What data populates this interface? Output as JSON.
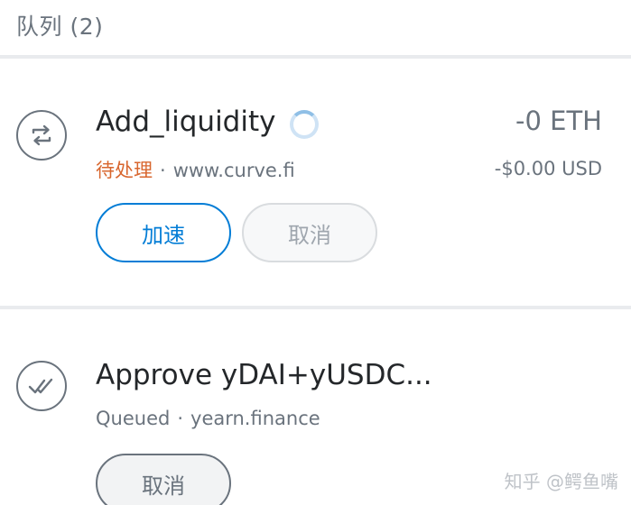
{
  "queue": {
    "title": "队列 (2)"
  },
  "transactions": [
    {
      "title": "Add_liquidity",
      "status": "待处理",
      "separator": "·",
      "origin": "www.curve.fi",
      "amount_primary": "-0 ETH",
      "amount_secondary": "-$0.00 USD",
      "speed_up_label": "加速",
      "cancel_label": "取消",
      "icon": "swap-arrows-icon",
      "status_color": "#d8662e"
    },
    {
      "title": "Approve yDAI+yUSDC...",
      "status": "Queued",
      "separator": "·",
      "origin": "yearn.finance",
      "cancel_label": "取消",
      "icon": "double-check-icon"
    }
  ],
  "watermark": "知乎 @鳄鱼嘴",
  "colors": {
    "primary": "#037dd6",
    "pending": "#d8662e",
    "muted": "#6a737d"
  }
}
